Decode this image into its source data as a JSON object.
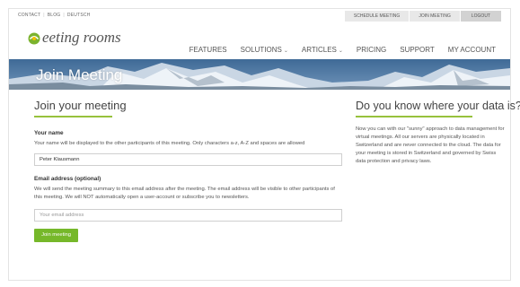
{
  "topbar": {
    "links": [
      "CONTACT",
      "BLOG",
      "DEUTSCH"
    ],
    "buttons": {
      "schedule": "SCHEDULE MEETING",
      "join": "JOIN MEETING",
      "logout": "LOGOUT"
    }
  },
  "logo": {
    "text": "eeting rooms"
  },
  "nav": {
    "items": [
      {
        "label": "FEATURES",
        "dropdown": false
      },
      {
        "label": "SOLUTIONS",
        "dropdown": true
      },
      {
        "label": "ARTICLES",
        "dropdown": true
      },
      {
        "label": "PRICING",
        "dropdown": false
      },
      {
        "label": "SUPPORT",
        "dropdown": false
      },
      {
        "label": "MY ACCOUNT",
        "dropdown": false
      }
    ]
  },
  "banner": {
    "title": "Join Meeting"
  },
  "form": {
    "heading": "Join your meeting",
    "name_label": "Your name",
    "name_help": "Your name will be displayed to the other participants of this meeting. Only characters a-z, A-Z and spaces are allowed",
    "name_value": "Peter Klausmann",
    "email_label": "Email address (optional)",
    "email_help": "We will send the meeting summary to this email address after the meeting. The email address will be visible to other participants of this meeting. We will NOT automatically open a user-account or subscribe you to newsletters.",
    "email_placeholder": "Your email address",
    "submit_label": "Join meeting"
  },
  "sidebar": {
    "heading": "Do you know where your data is?",
    "text": "Now you can with our \"sunny\" approach to data management for virtual meetings. All our servers are physically located in Switzerland and are never connected to the cloud. The data for your meeting is stored in Switzerland and governed by Swiss data protection and privacy laws."
  },
  "colors": {
    "accent": "#76b82a",
    "underline": "#97c23c",
    "banner": "#4b6f94"
  },
  "icons": {
    "logo": "sun-logo-icon",
    "caret": "chevron-down-icon"
  }
}
